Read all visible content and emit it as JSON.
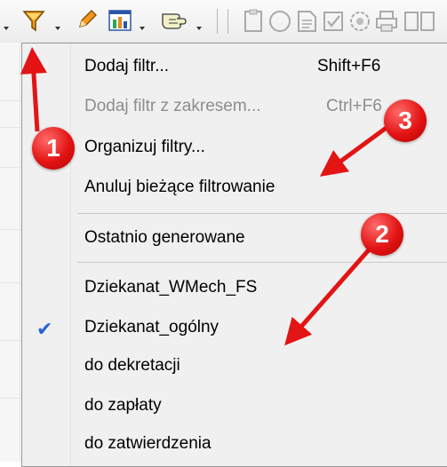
{
  "menu": {
    "items": [
      {
        "label": "Dodaj filtr...",
        "shortcut": "Shift+F6",
        "disabled": false
      },
      {
        "label": "Dodaj filtr z zakresem...",
        "shortcut": "Ctrl+F6",
        "disabled": true
      },
      {
        "label": "Organizuj filtry...",
        "shortcut": "",
        "disabled": false
      },
      {
        "label": "Anuluj bieżące filtrowanie",
        "shortcut": "",
        "disabled": false
      },
      {
        "label": "Ostatnio generowane",
        "shortcut": "",
        "disabled": false
      },
      {
        "label": "Dziekanat_WMech_FS",
        "shortcut": "",
        "disabled": false
      },
      {
        "label": "Dziekanat_ogólny",
        "shortcut": "",
        "disabled": false,
        "checked": true
      },
      {
        "label": "do dekretacji",
        "shortcut": "",
        "disabled": false
      },
      {
        "label": "do zapłaty",
        "shortcut": "",
        "disabled": false
      },
      {
        "label": "do zatwierdzenia",
        "shortcut": "",
        "disabled": false
      }
    ],
    "check_symbol": "✔"
  },
  "annotations": {
    "badge1": "1",
    "badge2": "2",
    "badge3": "3",
    "color": "#e31414"
  },
  "toolbar": {
    "icons": [
      "filter-icon",
      "pencil-icon",
      "chart-icon",
      "hand-icon"
    ],
    "disabled_icons": [
      "clipboard-icon",
      "circle-icon",
      "document-icon",
      "checkbox-icon",
      "settings-icon",
      "printer-icon"
    ]
  }
}
